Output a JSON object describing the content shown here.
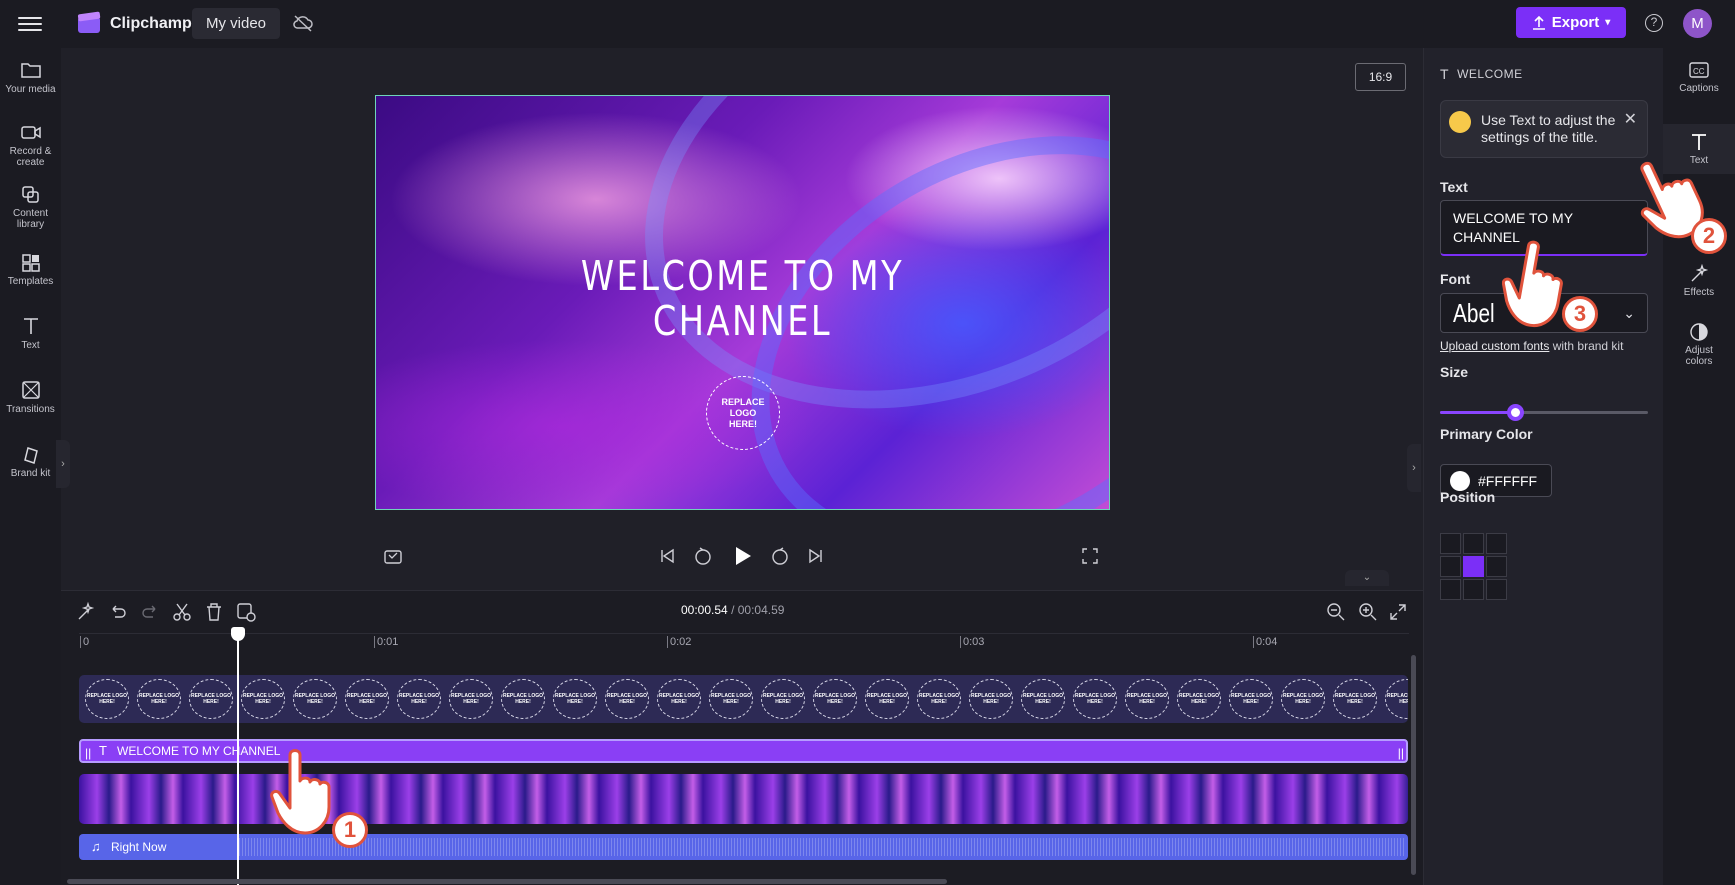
{
  "app": {
    "brand": "Clipchamp",
    "project_name": "My video",
    "export_label": "Export",
    "avatar_initial": "M",
    "help_glyph": "?"
  },
  "left_nav": [
    {
      "label": "Your media",
      "icon": "folder-icon"
    },
    {
      "label": "Record & create",
      "icon": "camera-icon"
    },
    {
      "label": "Content library",
      "icon": "library-icon"
    },
    {
      "label": "Templates",
      "icon": "templates-icon"
    },
    {
      "label": "Text",
      "icon": "text-icon"
    },
    {
      "label": "Transitions",
      "icon": "transitions-icon"
    },
    {
      "label": "Brand kit",
      "icon": "brand-kit-icon"
    }
  ],
  "preview": {
    "aspect_ratio": "16:9",
    "title_line1": "WELCOME TO MY",
    "title_line2": "CHANNEL",
    "logo_placeholder": "REPLACE LOGO HERE!"
  },
  "timeline": {
    "current_time": "00:00.54",
    "total_time": "/ 00:04.59",
    "ticks": [
      "0",
      "0:01",
      "0:02",
      "0:03",
      "0:04"
    ],
    "logo_clip_text": "REPLACE LOGO HERE!",
    "text_clip_label": "WELCOME TO MY CHANNEL",
    "audio_clip_label": "Right Now"
  },
  "right_panel": {
    "header": "WELCOME",
    "tip_text": "Use Text to adjust the settings of the title.",
    "text_label": "Text",
    "text_value": "WELCOME TO MY CHANNEL",
    "font_label": "Font",
    "font_value": "Abel",
    "upload_link": "Upload custom fonts",
    "upload_suffix": " with brand kit",
    "size_label": "Size",
    "size_value_fraction": 0.36,
    "primary_color_label": "Primary Color",
    "primary_color_value": "#FFFFFF",
    "position_label": "Position",
    "position_selected": "middle-center"
  },
  "right_nav": [
    {
      "label": "Captions",
      "icon": "captions-icon"
    },
    {
      "label": "Text",
      "icon": "text-icon",
      "active": true
    },
    {
      "label": "Effects",
      "icon": "effects-icon"
    },
    {
      "label": "Adjust colors",
      "icon": "adjust-colors-icon"
    }
  ],
  "tutorial_steps": [
    "1",
    "2",
    "3"
  ],
  "colors": {
    "accent": "#7B2FF7",
    "highlight_border": "#6FD5B9",
    "tutorial_badge": "#E0533C"
  }
}
